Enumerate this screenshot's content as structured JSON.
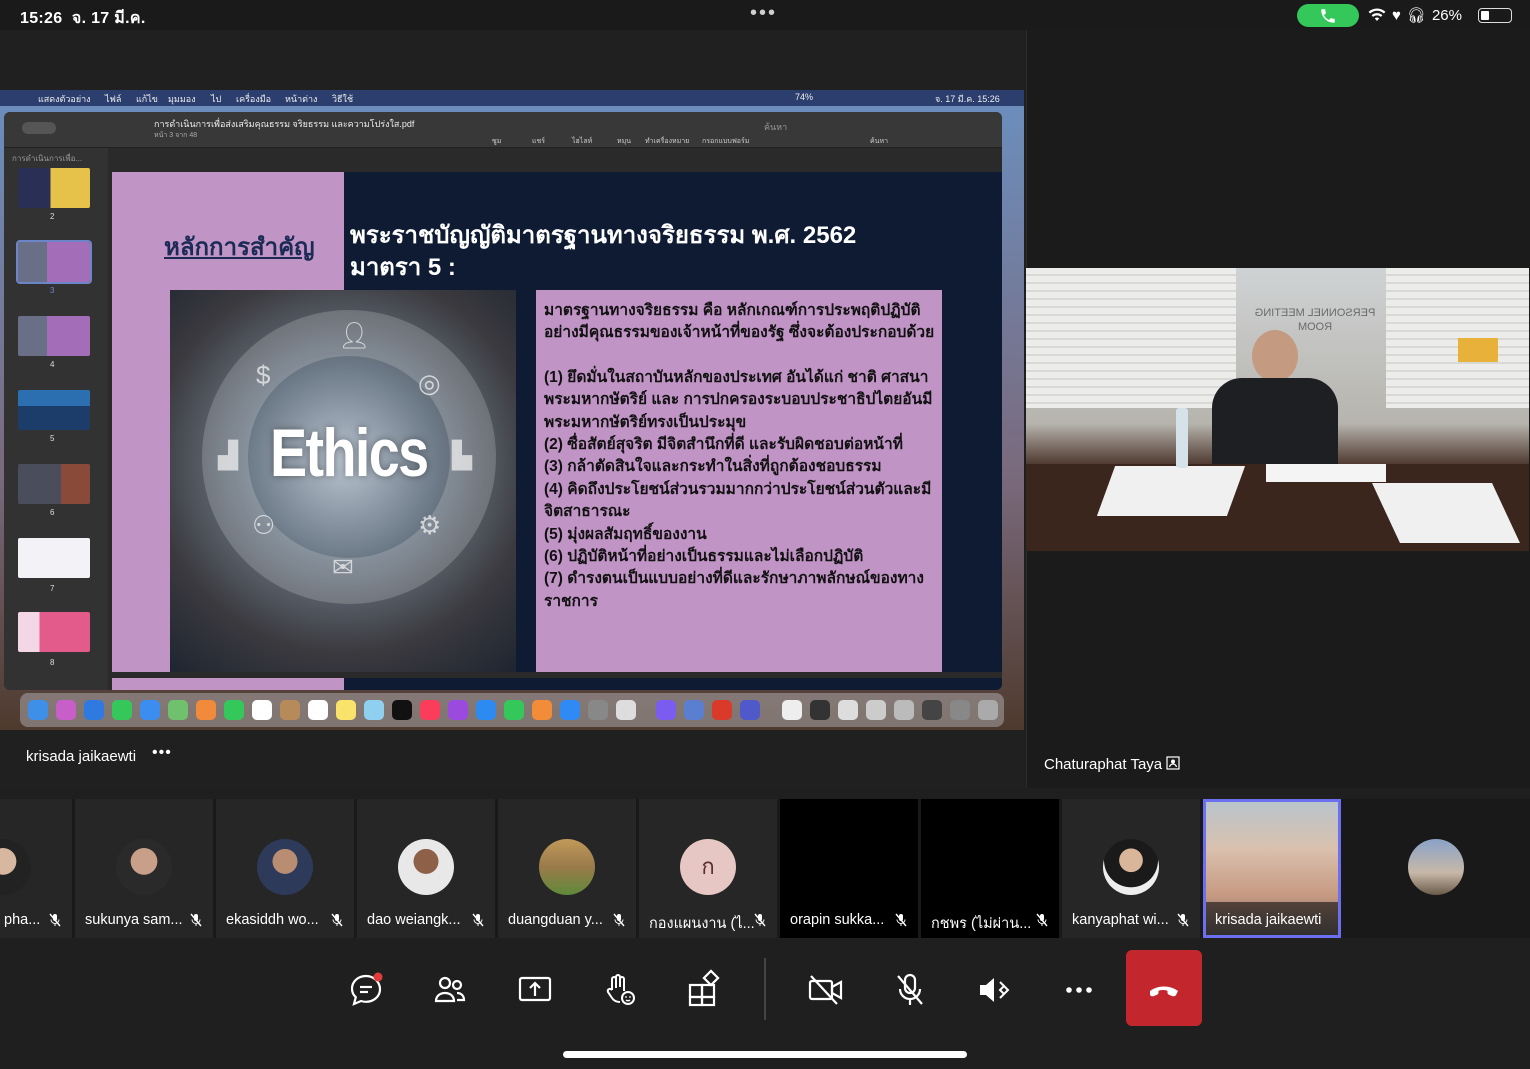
{
  "status_bar": {
    "time": "15:26",
    "date": "จ. 17 มี.ค.",
    "battery": "26%",
    "icons": [
      "wifi-icon",
      "heart-icon",
      "headphones-icon"
    ]
  },
  "mac": {
    "menu": [
      "แสดงตัวอย่าง",
      "ไฟล์",
      "แก้ไข",
      "มุมมอง",
      "ไป",
      "เครื่องมือ",
      "หน้าต่าง",
      "วิธีใช้"
    ],
    "battery": "74%",
    "clock": "จ. 17 มี.ค.  15:26"
  },
  "pdf": {
    "title": "การดำเนินการเพื่อส่งเสริมคุณธรรม จริยธรรม และความโปร่งใส.pdf",
    "page_info": "หน้า 3 จาก 48",
    "search_placeholder": "ค้นหา",
    "toolbar_labels": [
      "ซูม",
      "แชร์",
      "ไฮไลท์",
      "หมุน",
      "ทำเครื่องหมาย",
      "กรอกแบบฟอร์ม",
      "ค้นหา"
    ],
    "sidebar_title": "การดำเนินการเพื่อ...",
    "thumbs": [
      "2",
      "3",
      "4",
      "5",
      "6",
      "7",
      "8"
    ]
  },
  "slide": {
    "left_heading": "หลักการสำคัญ",
    "right_heading_1": "พระราชบัญญัติมาตรฐานทางจริยธรรม พ.ศ. 2562",
    "right_heading_2": "มาตรา 5 :",
    "photo_word": "Ethics",
    "intro": "มาตรฐานทางจริยธรรม คือ หลักเกณฑ์การประพฤติปฏิบัติอย่างมีคุณธรรมของเจ้าหน้าที่ของรัฐ ซึ่งจะต้องประกอบด้วย",
    "items": [
      "(1) ยึดมั่นในสถาบันหลักของประเทศ อันได้แก่ ชาติ ศาสนา พระมหากษัตริย์ และ การปกครองระบอบประชาธิปไตยอันมีพระมหากษัตริย์ทรงเป็นประมุข",
      "(2) ซื่อสัตย์สุจริต มีจิตสำนึกที่ดี และรับผิดชอบต่อหน้าที่",
      "(3) กล้าตัดสินใจและกระทำในสิ่งที่ถูกต้องชอบธรรม",
      "(4) คิดถึงประโยชน์ส่วนรวมมากกว่าประโยชน์ส่วนตัวและมีจิตสาธารณะ",
      "(5) มุ่งผลสัมฤทธิ์ของงาน",
      "(6) ปฏิบัติหน้าที่อย่างเป็นธรรมและไม่เลือกปฏิบัติ",
      "(7) ดำรงตนเป็นแบบอย่างที่ดีและรักษาภาพลักษณ์ของทางราชการ"
    ]
  },
  "stage": {
    "left_name": "krisada jaikaewti",
    "more": "•••",
    "right_name": "Chaturaphat Taya",
    "room_sign": "PERSONNEL MEETING ROOM"
  },
  "participants": [
    {
      "name": "pha...",
      "avatar": "photo"
    },
    {
      "name": "sukunya sam...",
      "avatar": "photo"
    },
    {
      "name": "ekasiddh wo...",
      "avatar": "photo"
    },
    {
      "name": "dao weiangk...",
      "avatar": "photo"
    },
    {
      "name": "duangduan y...",
      "avatar": "photo"
    },
    {
      "name": "กองแผนงาน (ไ...",
      "avatar": "initial",
      "initial": "ก"
    },
    {
      "name": "orapin sukka...",
      "avatar": "none"
    },
    {
      "name": "กชพร (ไม่ผ่าน...",
      "avatar": "none"
    },
    {
      "name": "kanyaphat wi...",
      "avatar": "photo"
    },
    {
      "name": "krisada jaikaewti",
      "avatar": "video",
      "active": true
    },
    {
      "name": "",
      "avatar": "photo"
    }
  ],
  "controls": [
    "chat-icon",
    "people-icon",
    "share-icon",
    "raise-hand-icon",
    "apps-icon",
    "camera-off-icon",
    "mic-off-icon",
    "speaker-icon",
    "more-icon",
    "hangup-icon"
  ],
  "colors": {
    "accent_active": "#6c6ff0",
    "hangup": "#c4262e",
    "call_pill": "#34c759",
    "slide_pink": "#c194c6",
    "slide_navy": "#0e1b33"
  }
}
